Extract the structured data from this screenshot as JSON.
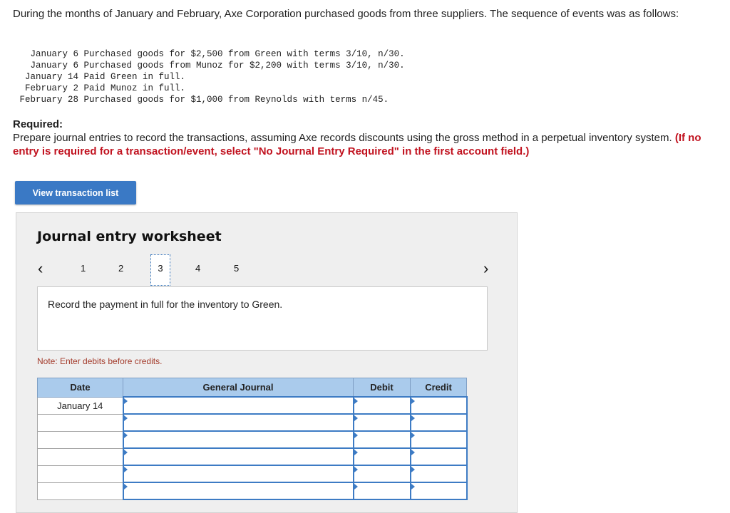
{
  "intro": "During the months of January and February, Axe Corporation purchased goods from three suppliers. The sequence of events was as follows:",
  "events": [
    {
      "date": "January 6",
      "text": "Purchased goods for $2,500 from Green with terms 3/10, n/30."
    },
    {
      "date": "January 6",
      "text": "Purchased goods from Munoz for $2,200 with terms 3/10, n/30."
    },
    {
      "date": "January 14",
      "text": "Paid Green in full."
    },
    {
      "date": "February 2",
      "text": "Paid Munoz in full."
    },
    {
      "date": "February 28",
      "text": "Purchased goods for $1,000 from Reynolds with terms n/45."
    }
  ],
  "required": {
    "heading": "Required:",
    "body": "Prepare journal entries to record the transactions, assuming Axe records discounts using the gross method in a perpetual inventory system. ",
    "instruction": "(If no entry is required for a transaction/event, select \"No Journal Entry Required\" in the first account field.)"
  },
  "view_button": "View transaction list",
  "worksheet": {
    "title": "Journal entry worksheet",
    "prev_icon": "chevron-left",
    "next_icon": "chevron-right",
    "pages": [
      "1",
      "2",
      "3",
      "4",
      "5"
    ],
    "active_page": "3",
    "description": "Record the payment in full for the inventory to Green.",
    "note": "Note: Enter debits before credits.",
    "table": {
      "headers": [
        "Date",
        "General Journal",
        "Debit",
        "Credit"
      ],
      "rows": [
        {
          "date": "January 14",
          "account": "",
          "debit": "",
          "credit": ""
        },
        {
          "date": "",
          "account": "",
          "debit": "",
          "credit": ""
        },
        {
          "date": "",
          "account": "",
          "debit": "",
          "credit": ""
        },
        {
          "date": "",
          "account": "",
          "debit": "",
          "credit": ""
        },
        {
          "date": "",
          "account": "",
          "debit": "",
          "credit": ""
        },
        {
          "date": "",
          "account": "",
          "debit": "",
          "credit": ""
        }
      ]
    }
  }
}
